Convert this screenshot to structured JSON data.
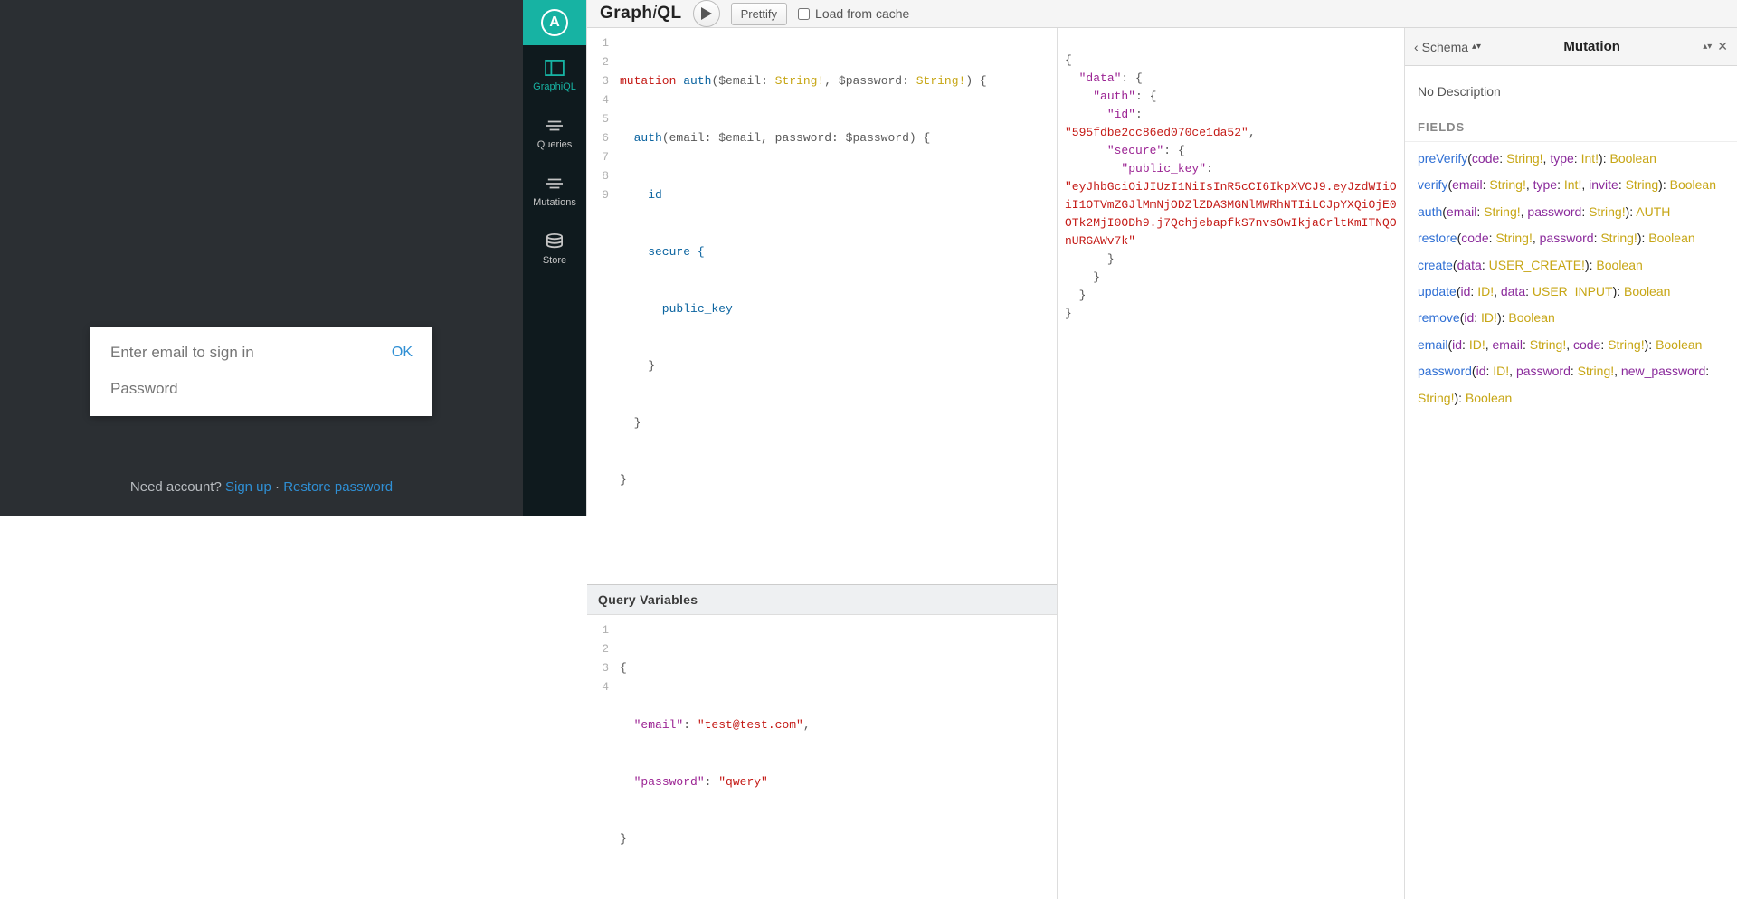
{
  "login": {
    "email_placeholder": "Enter email to sign in",
    "ok_label": "OK",
    "password_placeholder": "Password",
    "footer_text": "Need account? ",
    "signup_label": "Sign up",
    "sep": " · ",
    "restore_label": "Restore password"
  },
  "sidebar": {
    "logo_letter": "A",
    "items": [
      {
        "label": "GraphiQL"
      },
      {
        "label": "Queries"
      },
      {
        "label": "Mutations"
      },
      {
        "label": "Store"
      }
    ]
  },
  "toolbar": {
    "title_prefix": "Graph",
    "title_em": "i",
    "title_suffix": "QL",
    "prettify_label": "Prettify",
    "cache_label": "Load from cache"
  },
  "query": {
    "line_numbers": [
      "1",
      "2",
      "3",
      "4",
      "5",
      "6",
      "7",
      "8",
      "9"
    ],
    "tokens": {
      "l1_kw": "mutation",
      "l1_def": " auth",
      "l1_p1": "(",
      "l1_v1": "$email",
      "l1_c1": ": ",
      "l1_t1": "String!",
      "l1_cm": ", ",
      "l1_v2": "$password",
      "l1_c2": ": ",
      "l1_t2": "String!",
      "l1_p2": ") {",
      "l2_fn": "  auth",
      "l2_p1": "(email: ",
      "l2_v1": "$email",
      "l2_cm": ", password: ",
      "l2_v2": "$password",
      "l2_p2": ") {",
      "l3": "    id",
      "l4": "    secure {",
      "l5": "      public_key",
      "l6": "    }",
      "l7": "  }",
      "l8": "}",
      "l9": ""
    }
  },
  "query_variables": {
    "title": "Query Variables",
    "line_numbers": [
      "1",
      "2",
      "3",
      "4"
    ],
    "tokens": {
      "l1": "{",
      "l2_k": "\"email\"",
      "l2_c": ": ",
      "l2_v": "\"test@test.com\"",
      "l2_e": ",",
      "l3_k": "\"password\"",
      "l3_c": ": ",
      "l3_v": "\"qwery\"",
      "l4": "}"
    }
  },
  "result": {
    "l1": "{",
    "l2_k": "  \"data\"",
    "l2_r": ": {",
    "l3_k": "    \"auth\"",
    "l3_r": ": {",
    "l4_k": "      \"id\"",
    "l4_r": ": ",
    "l4_v": "\"595fdbe2cc86ed070ce1da52\"",
    "l4_c": ",",
    "l5_k": "      \"secure\"",
    "l5_r": ": {",
    "l6_k": "        \"public_key\"",
    "l6_r": ": ",
    "l7_v": "\"eyJhbGciOiJIUzI1NiIsInR5cCI6IkpXVCJ9.eyJzdWIiOiI1OTVmZGJlMmNjODZlZDA3MGNlMWRhNTIiLCJpYXQiOjE0OTk2MjI0ODh9.j7QchjebapfkS7nvsOwIkjaCrltKmITNQOnURGAWv7k\"",
    "l8": "      }",
    "l9": "    }",
    "l10": "  }",
    "l11": "}"
  },
  "docs": {
    "back_label": "Schema",
    "title": "Mutation",
    "description": "No Description",
    "section": "FIELDS",
    "fields": [
      {
        "fn": "preVerify",
        "args": [
          {
            "n": "code",
            "t": "String!"
          },
          {
            "n": "type",
            "t": "Int!"
          }
        ],
        "ret": "Boolean"
      },
      {
        "fn": "verify",
        "args": [
          {
            "n": "email",
            "t": "String!"
          },
          {
            "n": "type",
            "t": "Int!"
          },
          {
            "n": "invite",
            "t": "String"
          }
        ],
        "ret": "Boolean"
      },
      {
        "fn": "auth",
        "args": [
          {
            "n": "email",
            "t": "String!"
          },
          {
            "n": "password",
            "t": "String!"
          }
        ],
        "ret": "AUTH"
      },
      {
        "fn": "restore",
        "args": [
          {
            "n": "code",
            "t": "String!"
          },
          {
            "n": "password",
            "t": "String!"
          }
        ],
        "ret": "Boolean"
      },
      {
        "fn": "create",
        "args": [
          {
            "n": "data",
            "t": "USER_CREATE!"
          }
        ],
        "ret": "Boolean"
      },
      {
        "fn": "update",
        "args": [
          {
            "n": "id",
            "t": "ID!"
          },
          {
            "n": "data",
            "t": "USER_INPUT"
          }
        ],
        "ret": "Boolean"
      },
      {
        "fn": "remove",
        "args": [
          {
            "n": "id",
            "t": "ID!"
          }
        ],
        "ret": "Boolean"
      },
      {
        "fn": "email",
        "args": [
          {
            "n": "id",
            "t": "ID!"
          },
          {
            "n": "email",
            "t": "String!"
          },
          {
            "n": "code",
            "t": "String!"
          }
        ],
        "ret": "Boolean"
      },
      {
        "fn": "password",
        "args": [
          {
            "n": "id",
            "t": "ID!"
          },
          {
            "n": "password",
            "t": "String!"
          },
          {
            "n": "new_password",
            "t": "String!"
          }
        ],
        "ret": "Boolean"
      }
    ]
  }
}
